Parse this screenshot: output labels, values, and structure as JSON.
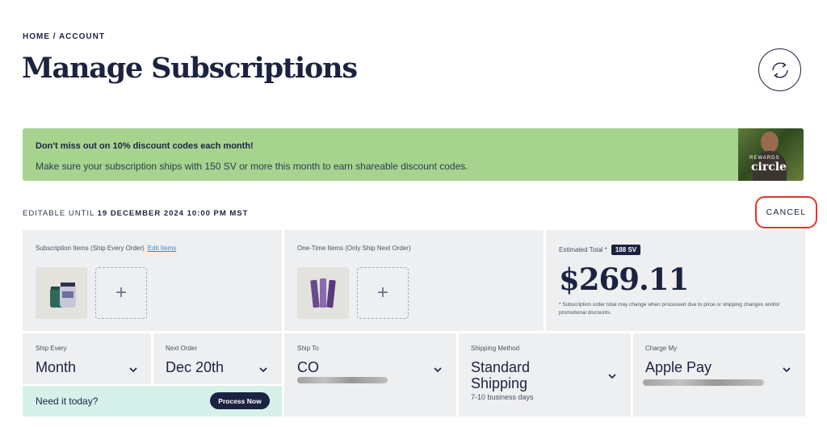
{
  "breadcrumb": "HOME / ACCOUNT",
  "page_title": "Manage Subscriptions",
  "promo": {
    "headline": "Don't miss out on 10% discount codes each month!",
    "body": "Make sure your subscription ships with 150 SV or more this month to earn shareable discount codes.",
    "image_text_small": "REWARDS",
    "image_text_large": "circle"
  },
  "editable": {
    "prefix": "EDITABLE UNTIL ",
    "deadline": "19 DECEMBER 2024 10:00 PM MST"
  },
  "cancel_label": "CANCEL",
  "subscription_items": {
    "label": "Subscription Items (Ship Every Order)",
    "edit_link": "Edit Items",
    "add_symbol": "+"
  },
  "one_time_items": {
    "label": "One-Time Items (Only Ship Next Order)",
    "add_symbol": "+"
  },
  "estimate": {
    "label": "Estimated Total *",
    "sv_badge": "188 SV",
    "total": "$269.11",
    "note": "* Subscription order total may change when processed due to price or shipping changes and/or promotional discounts."
  },
  "ship_every": {
    "label": "Ship Every",
    "value": "Month"
  },
  "next_order": {
    "label": "Next Order",
    "value": "Dec 20th"
  },
  "ship_to": {
    "label": "Ship To",
    "value": "CO"
  },
  "shipping_method": {
    "label": "Shipping Method",
    "value": "Standard Shipping",
    "detail": "7-10 business days"
  },
  "charge_my": {
    "label": "Charge My",
    "value": "Apple Pay"
  },
  "need_it": {
    "text": "Need it today?",
    "button": "Process Now"
  },
  "colors": {
    "navy": "#1c2340",
    "promo_green": "#a6d48f",
    "panel_gray": "#eeeff1",
    "mint": "#d6f1ea",
    "link_blue": "#2d8fd6",
    "highlight_red": "#e5352b"
  }
}
